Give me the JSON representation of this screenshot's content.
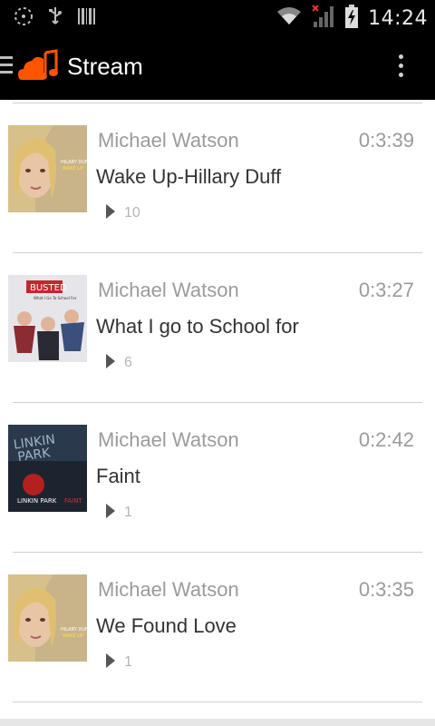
{
  "status_bar": {
    "time": "14:24",
    "icons": [
      "notification-icon",
      "usb-icon",
      "barcode-icon",
      "wifi-icon",
      "signal-icon",
      "battery-icon"
    ]
  },
  "action_bar": {
    "title": "Stream",
    "left_icons": [
      "menu-icon",
      "app-logo-icon"
    ],
    "right_icons": [
      "overflow-menu-icon"
    ]
  },
  "tracks": [
    {
      "artist": "Michael Watson",
      "duration": "0:3:39",
      "title": "Wake Up-Hillary Duff",
      "plays": "10",
      "artwork": "hilary-duff-wake-up-cover"
    },
    {
      "artist": "Michael Watson",
      "duration": "0:3:27",
      "title": "What I go to School for",
      "plays": "6",
      "artwork": "busted-cover"
    },
    {
      "artist": "Michael Watson",
      "duration": "0:2:42",
      "title": "Faint",
      "plays": "1",
      "artwork": "linkin-park-faint-cover"
    },
    {
      "artist": "Michael Watson",
      "duration": "0:3:35",
      "title": "We Found Love",
      "plays": "1",
      "artwork": "hilary-duff-wake-up-cover"
    }
  ],
  "colors": {
    "accent": "#ff5500",
    "bar_bg": "#000000",
    "secondary_text": "#9b9b9b",
    "primary_text": "#333333"
  }
}
